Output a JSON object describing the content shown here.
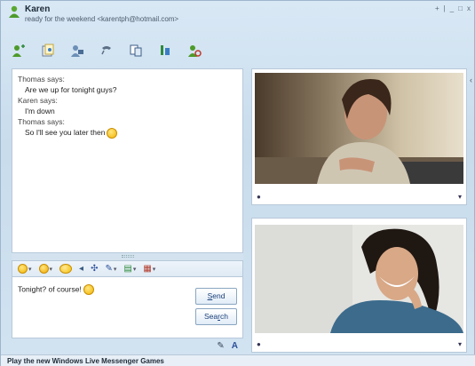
{
  "contact": {
    "name": "Karen",
    "status": "ready for the weekend <karentph@hotmail.com>"
  },
  "window_controls": [
    "+",
    "|",
    "_",
    "□",
    "x"
  ],
  "toolbar_icons": [
    "invite-contact-icon",
    "share-files-icon",
    "video-call-icon",
    "call-icon",
    "activities-icon",
    "games-icon",
    "block-contact-icon"
  ],
  "chat": {
    "lines": [
      {
        "who": "Thomas says:",
        "msg": "Are we up for tonight guys?"
      },
      {
        "who": "Karen says:",
        "msg": "I'm down"
      },
      {
        "who": "Thomas says:",
        "msg": "So I'll see you later then",
        "emoticon": "wink-emoticon"
      }
    ]
  },
  "format_bar": {
    "items": [
      "smile-emoticon-picker",
      "wink-emoticon-picker",
      "animated-emoticon-picker",
      "nudge-icon",
      "voice-clip-icon",
      "font-icon",
      "background-icon",
      "send-file-icon"
    ]
  },
  "compose": {
    "text": "Tonight? of course!",
    "emoticon": "smile-emoticon",
    "send_label_u": "S",
    "send_label_rest": "end",
    "search_label_pre": "Sea",
    "search_label_u": "r",
    "search_label_post": "ch"
  },
  "ad": {
    "text": "Play the new Windows Live Messenger Games"
  },
  "colors": {
    "accent": "#1b3f7a",
    "window_bg": "#d2e3f1"
  }
}
